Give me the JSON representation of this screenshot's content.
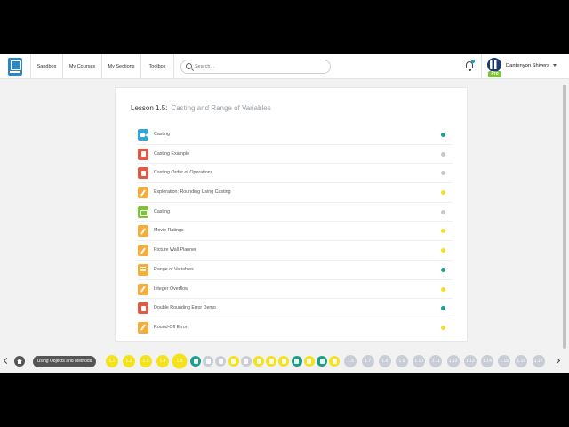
{
  "nav": {
    "links": [
      "Sandbox",
      "My Courses",
      "My Sections",
      "Toolbox"
    ],
    "search_placeholder": "Search...",
    "user_name": "Dantenyon Shivers",
    "pro_badge": "Pro"
  },
  "lesson": {
    "number": "Lesson 1.5:",
    "title": "Casting and Range of Variables",
    "items": [
      {
        "label": "Casting",
        "icon": "video-icon",
        "icon_color": "#35a4d8",
        "status_color": "#1e9e8a"
      },
      {
        "label": "Casting Example",
        "icon": "document-icon",
        "icon_color": "#e05a47",
        "status_color": "#c8c8c8"
      },
      {
        "label": "Casting Order of Operations",
        "icon": "document-icon",
        "icon_color": "#e05a47",
        "status_color": "#c8c8c8"
      },
      {
        "label": "Exploration: Rounding Using Casting",
        "icon": "pencil-icon",
        "icon_color": "#f5ac3a",
        "status_color": "#f1e024"
      },
      {
        "label": "Casting",
        "icon": "checklist-icon",
        "icon_color": "#7dc23b",
        "status_color": "#c8c8c8"
      },
      {
        "label": "Movie Ratings",
        "icon": "pencil-icon",
        "icon_color": "#f5ac3a",
        "status_color": "#f1e024"
      },
      {
        "label": "Picture Wall Planner",
        "icon": "pencil-icon",
        "icon_color": "#f5ac3a",
        "status_color": "#f1e024"
      },
      {
        "label": "Range of Variables",
        "icon": "list-icon",
        "icon_color": "#f5ac3a",
        "status_color": "#1e9e8a"
      },
      {
        "label": "Integer Overflow",
        "icon": "pencil-icon",
        "icon_color": "#f5ac3a",
        "status_color": "#f1e024"
      },
      {
        "label": "Double Rounding Error Demo",
        "icon": "document-icon",
        "icon_color": "#e05a47",
        "status_color": "#1e9e8a"
      },
      {
        "label": "Round-Off Error",
        "icon": "pencil-icon",
        "icon_color": "#f5ac3a",
        "status_color": "#f1e024"
      }
    ]
  },
  "bottom": {
    "unit_label": "Using Objects and Methods",
    "lessons_before": [
      "1.1",
      "1.2",
      "1.3",
      "1.4",
      "1.5"
    ],
    "activity_colors": [
      "#1e9e8a",
      "#c8cdd6",
      "#c8cdd6",
      "#f4e21a",
      "#c8cdd6",
      "#f4e21a",
      "#f4e21a",
      "#f4e21a",
      "#1e9e8a",
      "#f4e21a",
      "#1e9e8a",
      "#f4e21a"
    ],
    "lessons_after": [
      "1.6",
      "1.7",
      "1.8",
      "1.9",
      "1.10",
      "1.11",
      "1.12",
      "1.13",
      "1.14",
      "1.15",
      "1.16",
      "1.17"
    ]
  }
}
